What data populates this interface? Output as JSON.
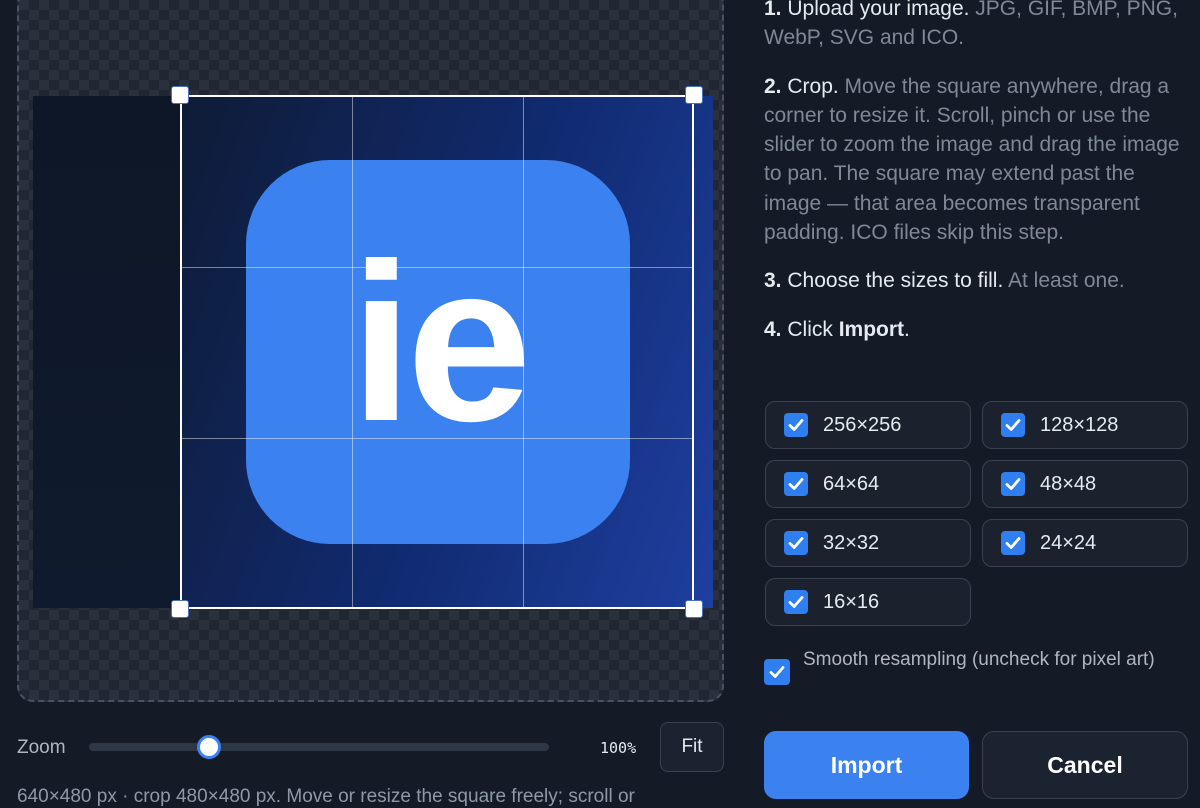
{
  "crop": {
    "preview_text": "ie"
  },
  "zoom": {
    "label": "Zoom",
    "value_text": "100%",
    "level_fraction": 0.26,
    "fit_label": "Fit"
  },
  "footer": {
    "info": "640×480 px · crop 480×480 px. Move or resize the square freely; scroll or"
  },
  "steps": [
    {
      "num": "1.",
      "title": "Upload your image.",
      "desc": " JPG, GIF, BMP, PNG, WebP, SVG and ICO."
    },
    {
      "num": "2.",
      "title": "Crop.",
      "desc": " Move the square anywhere, drag a corner to resize it. Scroll, pinch or use the slider to zoom the image and drag the image to pan. The square may extend past the image — that area becomes transparent padding. ICO files skip this step."
    },
    {
      "num": "3.",
      "title": "Choose the sizes to fill.",
      "desc": " At least one."
    },
    {
      "num": "4.",
      "title": "Click ",
      "bold": "Import",
      "end": "."
    }
  ],
  "sizes": [
    {
      "label": "256×256",
      "checked": true
    },
    {
      "label": "128×128",
      "checked": true
    },
    {
      "label": "64×64",
      "checked": true
    },
    {
      "label": "48×48",
      "checked": true
    },
    {
      "label": "32×32",
      "checked": true
    },
    {
      "label": "24×24",
      "checked": true
    },
    {
      "label": "16×16",
      "checked": true
    }
  ],
  "smooth": {
    "label": "Smooth resampling (uncheck for pixel art)",
    "checked": true
  },
  "actions": {
    "import_label": "Import",
    "cancel_label": "Cancel"
  },
  "colors": {
    "accent": "#3b82f0",
    "background": "#141b27"
  },
  "icons": {
    "check": "check-icon"
  }
}
